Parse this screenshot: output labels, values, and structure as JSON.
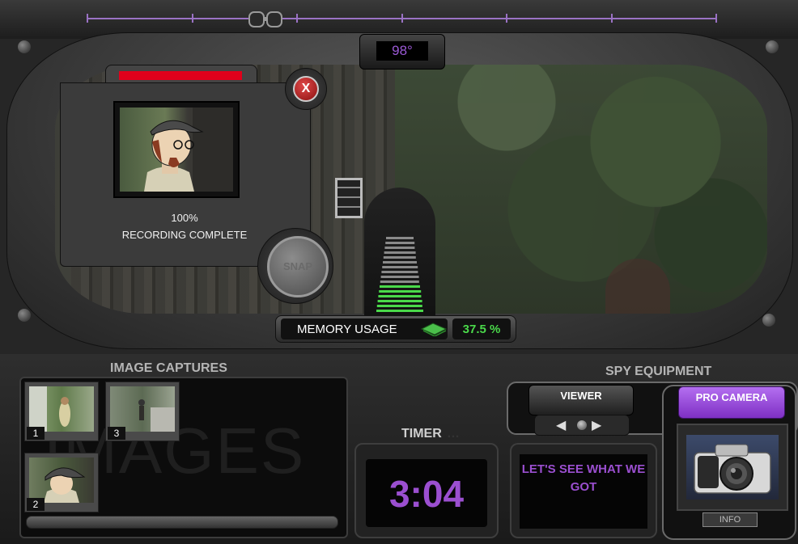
{
  "hud": {
    "temperature": "98°",
    "zoom_ticks": 7
  },
  "recording": {
    "percent": "100%",
    "status": "RECORDING COMPLETE",
    "progress_fraction": 1.0,
    "close_label": "X",
    "snap_label": "SNAP"
  },
  "memory": {
    "label": "MEMORY USAGE",
    "value": "37.5 %",
    "gauge_fraction": 0.375
  },
  "captures": {
    "title": "IMAGE CAPTURES",
    "watermark": "IMAGES",
    "items": [
      {
        "number": "1"
      },
      {
        "number": "3"
      },
      {
        "number": "2"
      }
    ]
  },
  "timer": {
    "title": "TIMER",
    "ghost": "…",
    "value": "3:04"
  },
  "message": {
    "text": "LET'S SEE WHAT WE GOT"
  },
  "spy_equipment": {
    "title": "SPY EQUIPMENT",
    "viewer_label": "VIEWER",
    "pro_camera_label": "PRO CAMERA",
    "info_label": "INFO"
  },
  "colors": {
    "accent_purple": "#9b4fd0",
    "memory_green": "#4ad94a",
    "record_red": "#e0001b"
  }
}
